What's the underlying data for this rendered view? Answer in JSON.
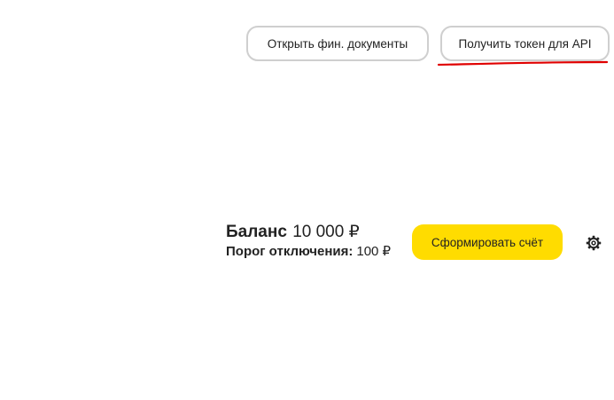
{
  "header": {
    "open_docs_label": "Открыть фин. документы",
    "get_token_label": "Получить токен для API"
  },
  "balance": {
    "label": "Баланс",
    "value": "10 000 ₽",
    "threshold_label": "Порог отключения:",
    "threshold_value": "100 ₽"
  },
  "actions": {
    "invoice_label": "Сформировать счёт"
  },
  "icons": {
    "settings": "gear-icon"
  },
  "colors": {
    "accent_yellow": "#ffdc00",
    "annotation_red": "#e00000",
    "pill_border": "#cfcfcf"
  }
}
